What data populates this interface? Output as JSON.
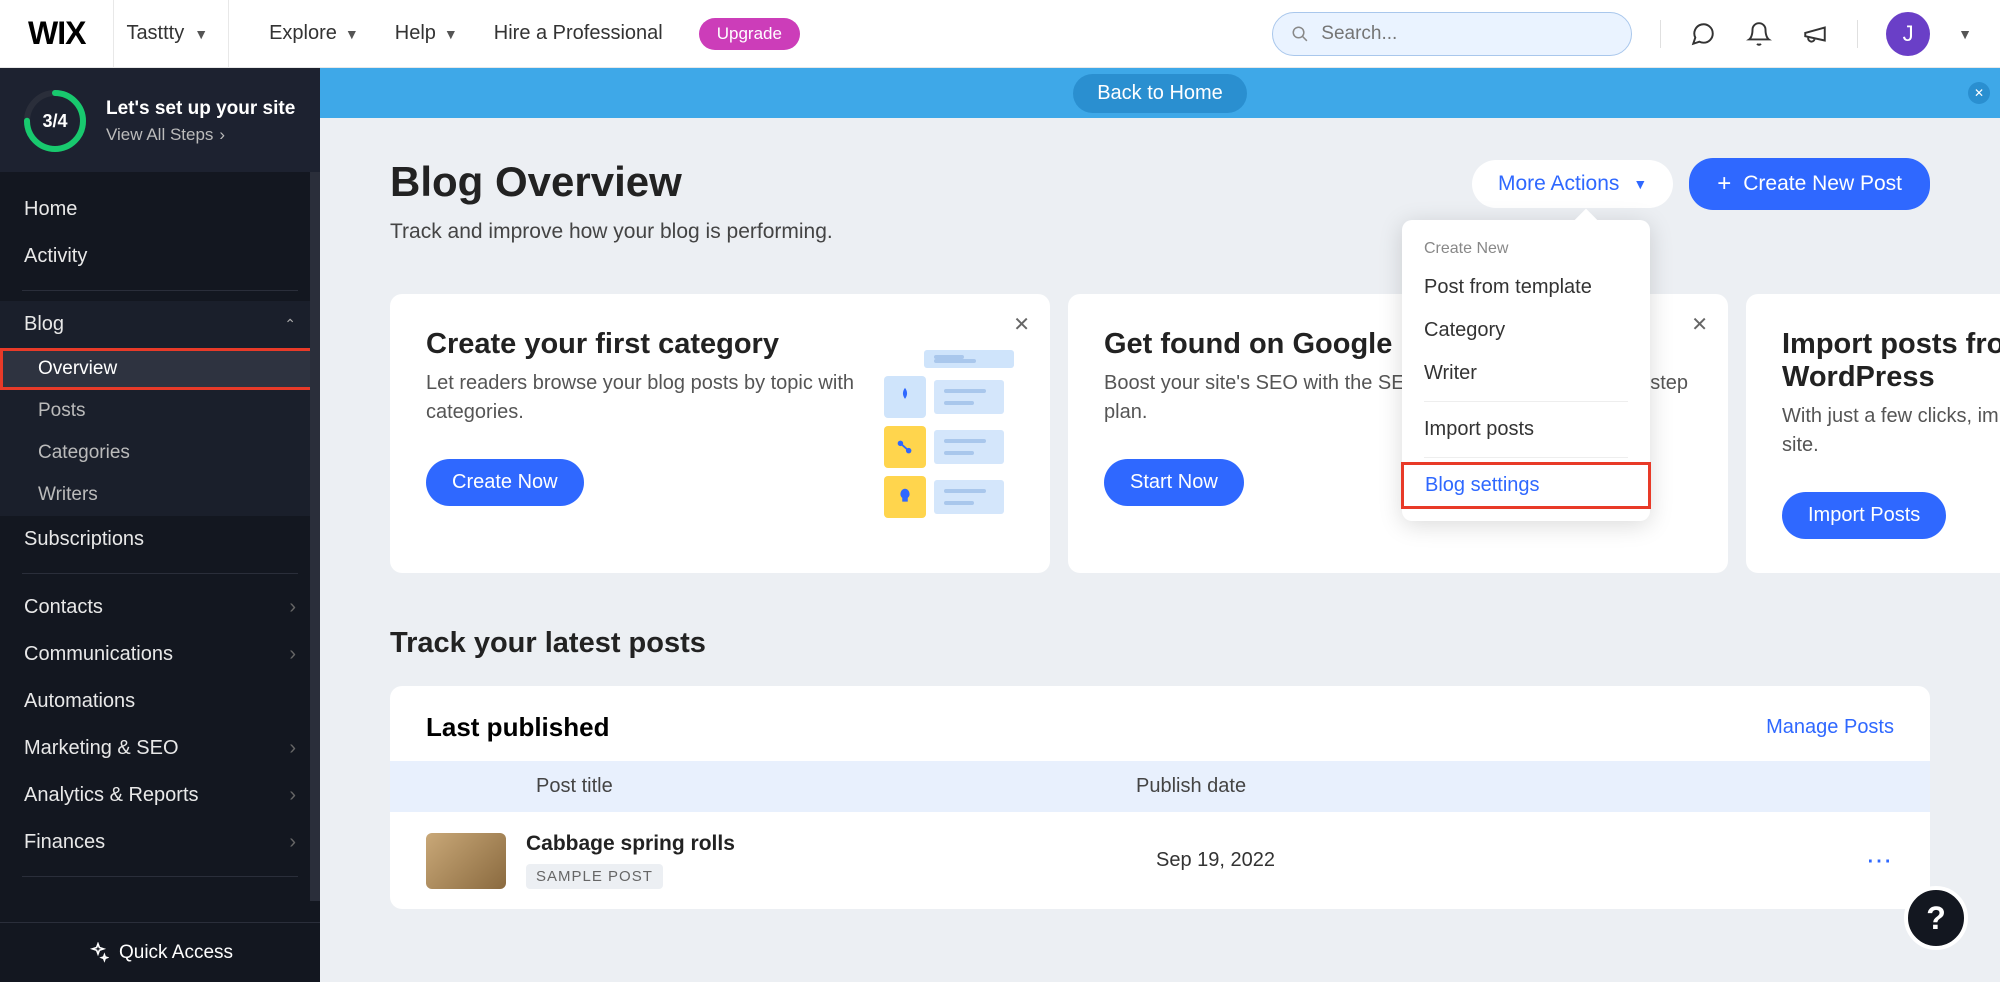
{
  "topbar": {
    "logo": "WIX",
    "site_name": "Tasttty",
    "nav": {
      "explore": "Explore",
      "help": "Help",
      "hire": "Hire a Professional"
    },
    "upgrade": "Upgrade",
    "search_placeholder": "Search...",
    "avatar_initial": "J"
  },
  "sidebar": {
    "setup": {
      "progress": "3/4",
      "title": "Let's set up your site",
      "view_all": "View All Steps"
    },
    "items": {
      "home": "Home",
      "activity": "Activity",
      "blog": "Blog",
      "blog_overview": "Overview",
      "blog_posts": "Posts",
      "blog_categories": "Categories",
      "blog_writers": "Writers",
      "subscriptions": "Subscriptions",
      "contacts": "Contacts",
      "communications": "Communications",
      "automations": "Automations",
      "marketing": "Marketing & SEO",
      "analytics": "Analytics & Reports",
      "finances": "Finances"
    },
    "quick_access": "Quick Access"
  },
  "banner": {
    "back": "Back to Home"
  },
  "page": {
    "title": "Blog Overview",
    "subtitle": "Track and improve how your blog is performing.",
    "more_actions": "More Actions",
    "create_post": "Create New Post"
  },
  "dropdown": {
    "heading": "Create New",
    "post_template": "Post from template",
    "category": "Category",
    "writer": "Writer",
    "import": "Import posts",
    "settings": "Blog settings"
  },
  "cards": [
    {
      "title": "Create your first category",
      "text": "Let readers browse your blog posts by topic with categories.",
      "button": "Create Now"
    },
    {
      "title": "Get found on Google",
      "text": "Boost your site's SEO with the SEO Wiz. Follow your step-by-step plan.",
      "button": "Start Now"
    },
    {
      "title": "Import posts from WordPress",
      "text": "With just a few clicks, import to your Wix site.",
      "button": "Import Posts"
    }
  ],
  "latest": {
    "section": "Track your latest posts",
    "header": "Last published",
    "manage": "Manage Posts",
    "col_title": "Post title",
    "col_date": "Publish date",
    "rows": [
      {
        "title": "Cabbage spring rolls",
        "badge": "SAMPLE POST",
        "date": "Sep 19, 2022"
      }
    ]
  },
  "help": "?"
}
